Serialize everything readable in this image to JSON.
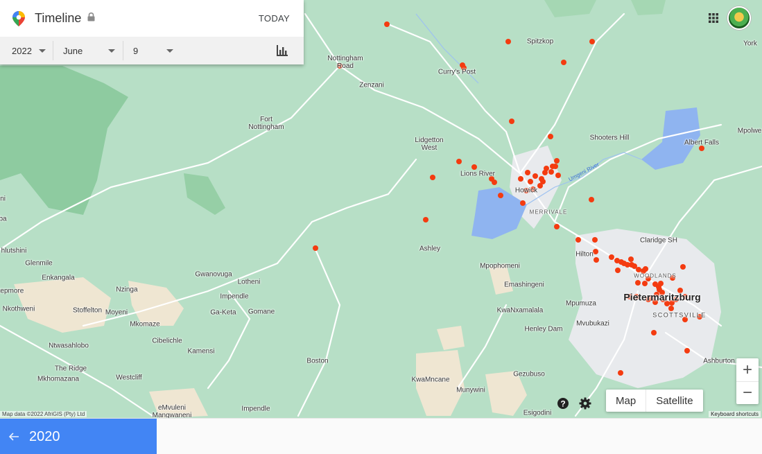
{
  "header": {
    "title": "Timeline",
    "today_label": "TODAY"
  },
  "filters": {
    "year": "2022",
    "month": "June",
    "day": "9"
  },
  "map_controls": {
    "map_label": "Map",
    "satellite_label": "Satellite",
    "zoom_in": "+",
    "zoom_out": "−",
    "attribution": "Map data ©2022 AfriGIS (Pty) Ltd",
    "shortcuts": "Keyboard shortcuts"
  },
  "bottom": {
    "year_label": "2020"
  },
  "places": [
    {
      "name": "Spitzkop"
    },
    {
      "name": "York"
    },
    {
      "name": "Nottingham\nRoad"
    },
    {
      "name": "Curry's Post"
    },
    {
      "name": "Zenzani"
    },
    {
      "name": "Fort\nNottingham"
    },
    {
      "name": "Lidgetton\nWest"
    },
    {
      "name": "Shooters Hill"
    },
    {
      "name": "Albert Falls"
    },
    {
      "name": "Mpolwe"
    },
    {
      "name": "Lions River"
    },
    {
      "name": "Howick"
    },
    {
      "name": "MERRIVALE"
    },
    {
      "name": "Umgeni River"
    },
    {
      "name": "Ashley"
    },
    {
      "name": "Claridge SH"
    },
    {
      "name": "Hilton"
    },
    {
      "name": "Mpophomeni"
    },
    {
      "name": "WOODLANDS"
    },
    {
      "name": "Pietermaritzburg"
    },
    {
      "name": "SCOTTSVILLE"
    },
    {
      "name": "hlutshini"
    },
    {
      "name": "Glenmile"
    },
    {
      "name": "Enkangala"
    },
    {
      "name": "tepmore"
    },
    {
      "name": "Nkothweni"
    },
    {
      "name": "Stoffelton"
    },
    {
      "name": "Moyeni"
    },
    {
      "name": "Nzinga"
    },
    {
      "name": "Gwanovuga"
    },
    {
      "name": "Lotheni"
    },
    {
      "name": "Impendle"
    },
    {
      "name": "Ga-Keta"
    },
    {
      "name": "Gomane"
    },
    {
      "name": "Emashingeni"
    },
    {
      "name": "Mpumuza"
    },
    {
      "name": "KwaNxamalala"
    },
    {
      "name": "Mvubukazi"
    },
    {
      "name": "Henley Dam"
    },
    {
      "name": "Mkomaze"
    },
    {
      "name": "Cibelichle"
    },
    {
      "name": "Kamensi"
    },
    {
      "name": "Ntwasahlobo"
    },
    {
      "name": "The Ridge"
    },
    {
      "name": "Mkhomazana"
    },
    {
      "name": "Westcliff"
    },
    {
      "name": "Boston"
    },
    {
      "name": "KwaMncane"
    },
    {
      "name": "Gezubuso"
    },
    {
      "name": "Munywini"
    },
    {
      "name": "Ashburton"
    },
    {
      "name": "eMvuleni\nMangwaneni"
    },
    {
      "name": "Impendle"
    },
    {
      "name": "Esigodini"
    },
    {
      "name": "ba"
    },
    {
      "name": "ini"
    }
  ],
  "colors": {
    "visit_marker": "#f43b10",
    "accent": "#4285f4",
    "water": "#8fb4f0",
    "urban": "#e8eaed",
    "forest": "#8ecba0"
  }
}
